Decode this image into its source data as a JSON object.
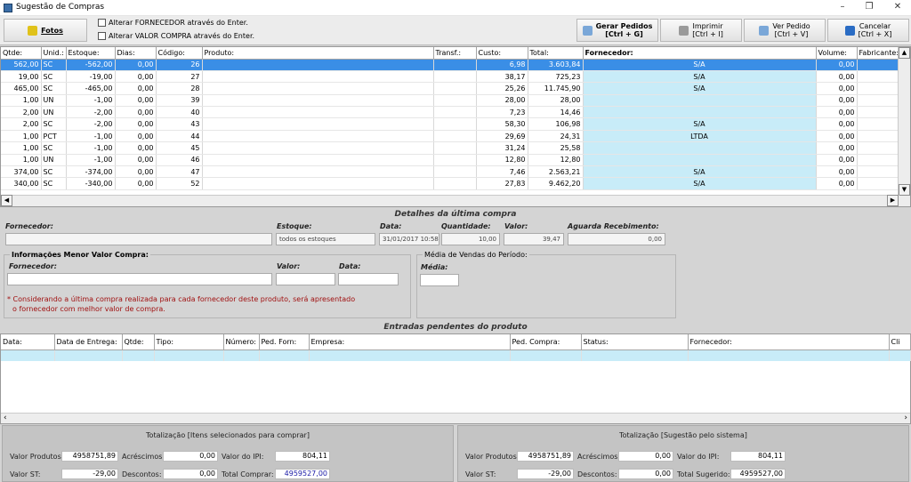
{
  "window": {
    "title": "Sugestão de Compras"
  },
  "toolbar": {
    "fotos_label": "Fotos",
    "check_fornecedor": "Alterar FORNECEDOR através do Enter.",
    "check_valor": "Alterar VALOR COMPRA através do Enter.",
    "gerar_label": "Gerar Pedidos",
    "gerar_shortcut": "[Ctrl + G]",
    "imprimir_label": "Imprimir",
    "imprimir_shortcut": "[Ctrl + I]",
    "ver_label": "Ver Pedido",
    "ver_shortcut": "[Ctrl + V]",
    "cancelar_label": "Cancelar",
    "cancelar_shortcut": "[Ctrl + X]"
  },
  "grid": {
    "columns": [
      "Qtde:",
      "Unid.:",
      "Estoque:",
      "Dias:",
      "Código:",
      "Produto:",
      "Transf.:",
      "Custo:",
      "Total:",
      "Fornecedor:",
      "Volume:",
      "Fabricante:"
    ],
    "rows": [
      {
        "qtde": "562,00",
        "unid": "SC",
        "estoque": "-562,00",
        "dias": "0,00",
        "codigo": "26",
        "produto": "",
        "transf": "",
        "custo": "6,98",
        "total": "3.603,84",
        "fornecedor": "S/A",
        "volume": "0,00",
        "fabricante": ""
      },
      {
        "qtde": "19,00",
        "unid": "SC",
        "estoque": "-19,00",
        "dias": "0,00",
        "codigo": "27",
        "produto": "",
        "transf": "",
        "custo": "38,17",
        "total": "725,23",
        "fornecedor": "S/A",
        "volume": "0,00",
        "fabricante": ""
      },
      {
        "qtde": "465,00",
        "unid": "SC",
        "estoque": "-465,00",
        "dias": "0,00",
        "codigo": "28",
        "produto": "",
        "transf": "",
        "custo": "25,26",
        "total": "11.745,90",
        "fornecedor": "S/A",
        "volume": "0,00",
        "fabricante": ""
      },
      {
        "qtde": "1,00",
        "unid": "UN",
        "estoque": "-1,00",
        "dias": "0,00",
        "codigo": "39",
        "produto": "",
        "transf": "",
        "custo": "28,00",
        "total": "28,00",
        "fornecedor": "",
        "volume": "0,00",
        "fabricante": ""
      },
      {
        "qtde": "2,00",
        "unid": "UN",
        "estoque": "-2,00",
        "dias": "0,00",
        "codigo": "40",
        "produto": "",
        "transf": "",
        "custo": "7,23",
        "total": "14,46",
        "fornecedor": "",
        "volume": "0,00",
        "fabricante": ""
      },
      {
        "qtde": "2,00",
        "unid": "SC",
        "estoque": "-2,00",
        "dias": "0,00",
        "codigo": "43",
        "produto": "",
        "transf": "",
        "custo": "58,30",
        "total": "106,98",
        "fornecedor": "S/A",
        "volume": "0,00",
        "fabricante": ""
      },
      {
        "qtde": "1,00",
        "unid": "PCT",
        "estoque": "-1,00",
        "dias": "0,00",
        "codigo": "44",
        "produto": "",
        "transf": "",
        "custo": "29,69",
        "total": "24,31",
        "fornecedor": "LTDA",
        "volume": "0,00",
        "fabricante": ""
      },
      {
        "qtde": "1,00",
        "unid": "SC",
        "estoque": "-1,00",
        "dias": "0,00",
        "codigo": "45",
        "produto": "",
        "transf": "",
        "custo": "31,24",
        "total": "25,58",
        "fornecedor": "",
        "volume": "0,00",
        "fabricante": ""
      },
      {
        "qtde": "1,00",
        "unid": "UN",
        "estoque": "-1,00",
        "dias": "0,00",
        "codigo": "46",
        "produto": "",
        "transf": "",
        "custo": "12,80",
        "total": "12,80",
        "fornecedor": "",
        "volume": "0,00",
        "fabricante": ""
      },
      {
        "qtde": "374,00",
        "unid": "SC",
        "estoque": "-374,00",
        "dias": "0,00",
        "codigo": "47",
        "produto": "",
        "transf": "",
        "custo": "7,46",
        "total": "2.563,21",
        "fornecedor": "S/A",
        "volume": "0,00",
        "fabricante": ""
      },
      {
        "qtde": "340,00",
        "unid": "SC",
        "estoque": "-340,00",
        "dias": "0,00",
        "codigo": "52",
        "produto": "",
        "transf": "",
        "custo": "27,83",
        "total": "9.462,20",
        "fornecedor": "S/A",
        "volume": "0,00",
        "fabricante": ""
      }
    ]
  },
  "detalhes": {
    "title": "Detalhes da última compra",
    "fornecedor_label": "Fornecedor:",
    "fornecedor_value": "",
    "estoque_label": "Estoque:",
    "estoque_value": "todos os estoques",
    "data_label": "Data:",
    "data_value": "31/01/2017 10:58",
    "quantidade_label": "Quantidade:",
    "quantidade_value": "10,00",
    "valor_label": "Valor:",
    "valor_value": "39,47",
    "aguarda_label": "Aguarda Recebimento:",
    "aguarda_value": "0,00"
  },
  "menor_valor": {
    "title": "Informações Menor Valor Compra:",
    "fornecedor_label": "Fornecedor:",
    "valor_label": "Valor:",
    "data_label": "Data:",
    "note_line1": "* Considerando a última compra realizada para cada fornecedor deste produto, será apresentado",
    "note_line2": "o fornecedor com melhor valor de compra."
  },
  "media": {
    "title": "Média de Vendas do Período:",
    "media_label": "Média:"
  },
  "pendentes": {
    "title": "Entradas pendentes do produto",
    "columns": [
      "Data:",
      "Data de Entrega:",
      "Qtde:",
      "Tipo:",
      "Número:",
      "Ped. Forn:",
      "Empresa:",
      "Ped. Compra:",
      "Status:",
      "Fornecedor:",
      "Cli"
    ]
  },
  "totais_selecionados": {
    "title": "Totalização [Itens selecionados para comprar]",
    "valor_produtos_label": "Valor Produtos:",
    "valor_produtos": "4958751,89",
    "acrescimos_label": "Acréscimos:",
    "acrescimos": "0,00",
    "ipi_label": "Valor do IPI:",
    "ipi": "804,11",
    "st_label": "Valor ST:",
    "st": "-29,00",
    "descontos_label": "Descontos:",
    "descontos": "0,00",
    "total_label": "Total Comprar:",
    "total": "4959527,00"
  },
  "totais_sistema": {
    "title": "Totalização [Sugestão pelo sistema]",
    "valor_produtos_label": "Valor Produtos:",
    "valor_produtos": "4958751,89",
    "acrescimos_label": "Acréscimos:",
    "acrescimos": "0,00",
    "ipi_label": "Valor do IPI:",
    "ipi": "804,11",
    "st_label": "Valor ST:",
    "st": "-29,00",
    "descontos_label": "Descontos:",
    "descontos": "0,00",
    "total_label": "Total Sugerido:",
    "total": "4959527,00"
  },
  "colors": {
    "selection": "#3a8ee6",
    "supplier_cell": "#c8ecf8",
    "note_red": "#a01010"
  },
  "icons": [
    "app-icon",
    "fotos-icon",
    "gerar-icon",
    "print-icon",
    "view-icon",
    "cancel-icon",
    "minimize-icon",
    "maximize-icon",
    "close-icon"
  ]
}
